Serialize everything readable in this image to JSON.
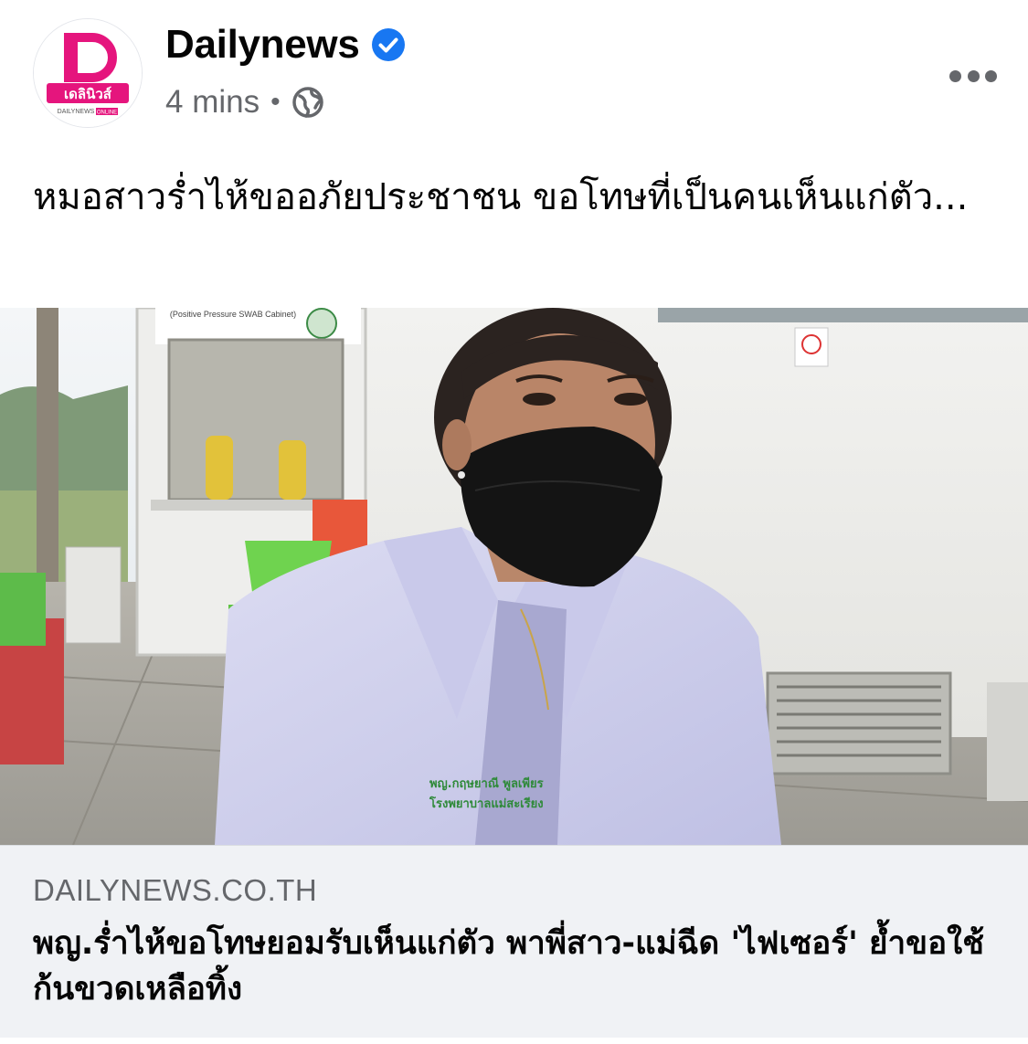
{
  "post": {
    "page_name": "Dailynews",
    "time": "4 mins",
    "separator": "•",
    "logo_text": "เดลินิวส์",
    "logo_sub": "DAILYNEWS",
    "logo_badge": "ONLINE",
    "caption": "หมอสาวร่ำไห้ขออภัยประชาชน ขอโทษที่เป็นคนเห็นแก่ตัว..."
  },
  "photo": {
    "sign_text": "(Positive Pressure SWAB Cabinet)",
    "coat_name": "พญ.กฤษยาณี พูลเพียร",
    "coat_org": "โรงพยาบาลแม่สะเรียง"
  },
  "link": {
    "domain": "DAILYNEWS.CO.TH",
    "title": "พญ.ร่ำไห้ขอโทษยอมรับเห็นแก่ตัว พาพี่สาว-แม่ฉีด 'ไฟเซอร์' ย้ำขอใช้ก้นขวดเหลือทิ้ง"
  },
  "colors": {
    "brand_pink": "#e5157d",
    "verified_blue": "#1877f2",
    "text_primary": "#050505",
    "text_secondary": "#65676b",
    "link_bg": "#f0f2f5"
  },
  "icons": [
    "verified-badge-icon",
    "globe-icon",
    "more-options-icon"
  ]
}
